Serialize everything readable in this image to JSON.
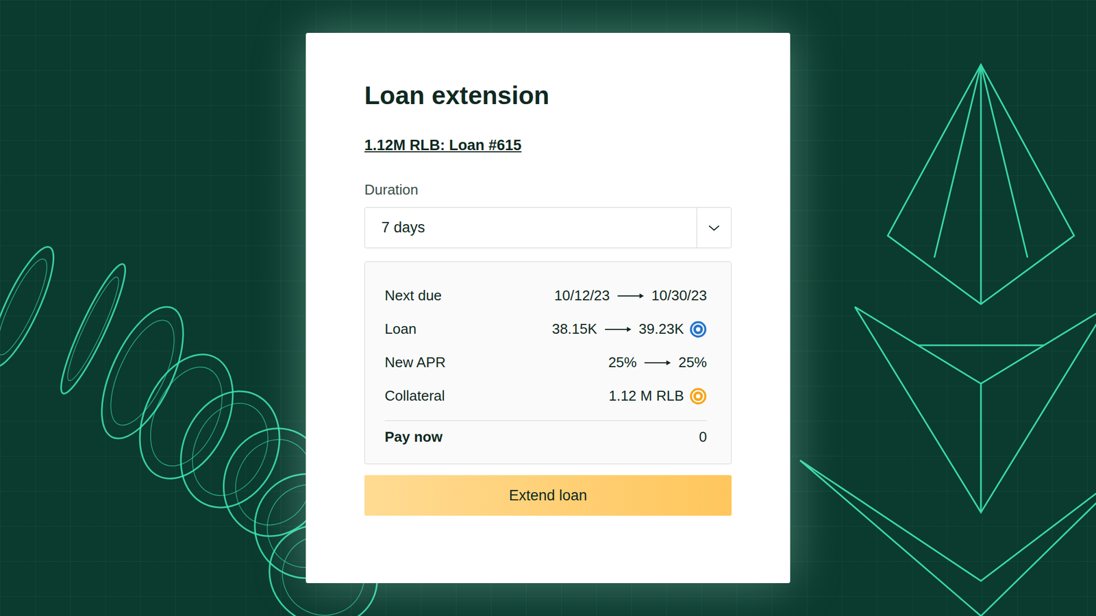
{
  "dialog": {
    "title": "Loan extension",
    "loan_link": "1.12M RLB: Loan #615",
    "duration": {
      "label": "Duration",
      "value": "7 days"
    },
    "summary": [
      {
        "kind": "change",
        "label": "Next due",
        "from": "10/12/23",
        "to": "10/30/23",
        "token_color": null
      },
      {
        "kind": "change",
        "label": "Loan",
        "from": "38.15K",
        "to": "39.23K",
        "token_color": "#2775ca"
      },
      {
        "kind": "change",
        "label": "New APR",
        "from": "25%",
        "to": "25%",
        "token_color": null
      },
      {
        "kind": "amount",
        "label": "Collateral",
        "value": "1.12 M RLB",
        "token_color": "#f7a51c"
      }
    ],
    "total": {
      "label": "Pay now",
      "value": "0"
    },
    "button": "Extend loan"
  }
}
